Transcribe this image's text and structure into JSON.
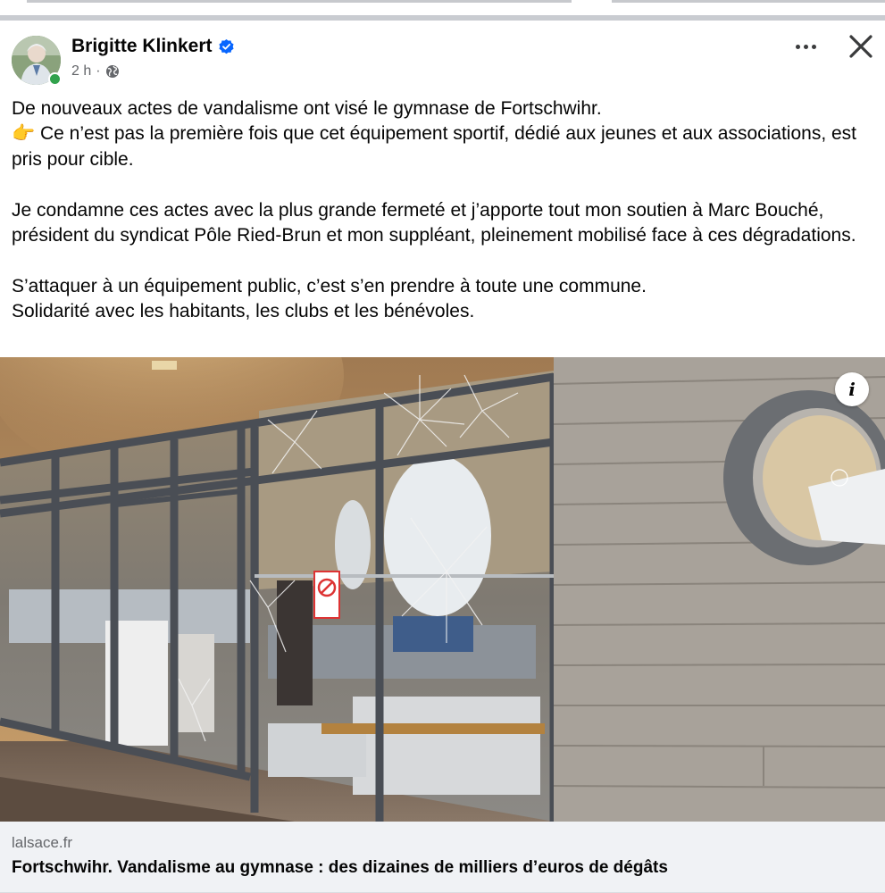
{
  "post": {
    "author": "Brigitte Klinkert",
    "verified": true,
    "time": "2 h",
    "separator": "·",
    "audience_icon": "globe-icon",
    "body": {
      "line1": "De nouveaux actes de vandalisme ont visé le gymnase de Fortschwihr.",
      "line2_emoji": "👉",
      "line2": " Ce n’est pas la première fois que cet équipement sportif, dédié aux jeunes et aux associations, est pris pour cible.",
      "paragraph2": "Je condamne ces actes avec la plus grande fermeté et j’apporte tout mon soutien à Marc Bouché, président du syndicat Pôle Ried-Brun et mon suppléant, pleinement mobilisé face à ces dégradations.",
      "paragraph3_line1": "S’attaquer à un équipement public, c’est s’en prendre à toute une commune.",
      "paragraph3_line2": "Solidarité avec les habitants, les clubs et les bénévoles."
    }
  },
  "link": {
    "domain": "lalsace.fr",
    "title": "Fortschwihr. Vandalisme au gymnase : des dizaines de milliers d’euros de dégâts"
  },
  "colors": {
    "verified_blue": "#0866ff",
    "online_green": "#31a24c",
    "text": "#050505",
    "secondary_text": "#65676b",
    "card_bg": "#f0f2f5"
  }
}
